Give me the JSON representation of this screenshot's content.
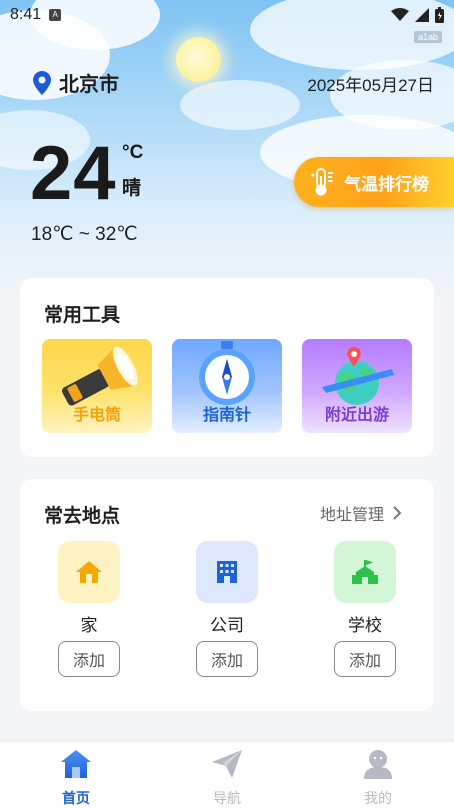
{
  "status_bar": {
    "time": "8:41"
  },
  "watermark": "a1ab",
  "weather": {
    "city": "北京市",
    "date": "2025年05月27日",
    "temperature": "24",
    "unit": "°C",
    "condition": "晴",
    "range": "18℃ ~ 32℃",
    "rank_button": "气温排行榜"
  },
  "tools": {
    "title": "常用工具",
    "items": [
      {
        "label": "手电筒",
        "color": "#f5a20a"
      },
      {
        "label": "指南针",
        "color": "#1e63d6"
      },
      {
        "label": "附近出游",
        "color": "#7b3fd6"
      }
    ]
  },
  "places": {
    "title": "常去地点",
    "manage_label": "地址管理",
    "items": [
      {
        "name": "家",
        "add_label": "添加",
        "icon": "home-icon"
      },
      {
        "name": "公司",
        "add_label": "添加",
        "icon": "building-icon"
      },
      {
        "name": "学校",
        "add_label": "添加",
        "icon": "school-icon"
      }
    ]
  },
  "tabbar": {
    "items": [
      {
        "label": "首页",
        "active": true
      },
      {
        "label": "导航",
        "active": false
      },
      {
        "label": "我的",
        "active": false
      }
    ],
    "active_color": "#1e63d6",
    "inactive_color": "#b5b9c4"
  }
}
